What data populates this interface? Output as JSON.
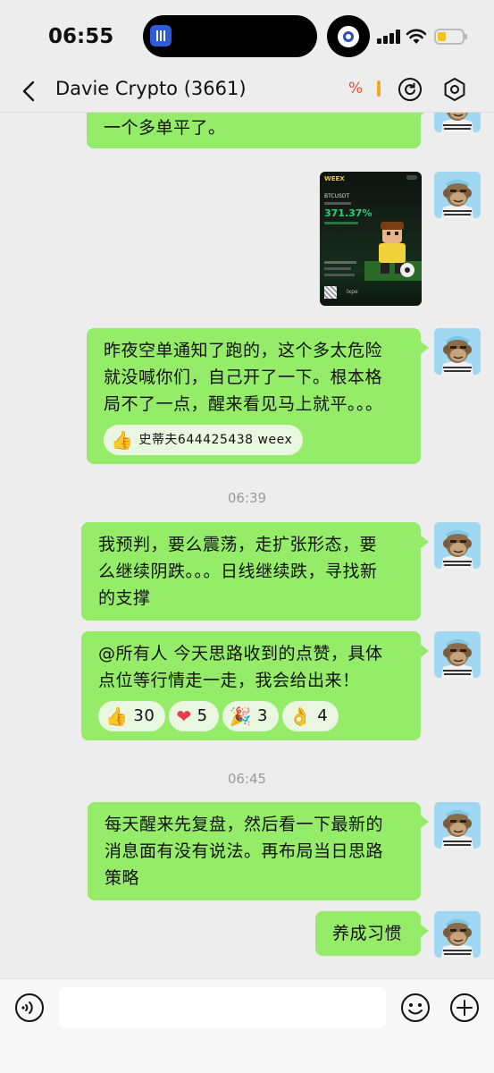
{
  "status_bar": {
    "time": "06:55"
  },
  "header": {
    "title": "Davie Crypto (3661)",
    "indicator": "%"
  },
  "messages": [
    {
      "text": "一个多单平了。"
    },
    {
      "type": "image",
      "card": {
        "brand": "WEEX",
        "pair": "BTCUSDT",
        "pnl": "371.37%",
        "footer": "lxpe"
      }
    },
    {
      "text_lines": [
        "昨夜空单通知了跑的，这个多太危险",
        "就没喊你们，自己开了一下。根本格",
        "局不了一点，醒来看见马上就平。。。"
      ],
      "reactions": [
        {
          "emoji": "👍",
          "label": "史蒂夫644425438 weex"
        }
      ]
    },
    {
      "timestamp": "06:39"
    },
    {
      "text_lines": [
        "我预判，要么震荡，走扩张形态，要",
        "么继续阴跌。。。日线继续跌，寻找新",
        "的支撑"
      ]
    },
    {
      "text_lines": [
        "@所有人 今天思路收到的点赞，具体",
        "点位等行情走一走，我会给出来！"
      ],
      "reactions": [
        {
          "emoji": "👍",
          "label": "30"
        },
        {
          "emoji": "❤",
          "label": "5"
        },
        {
          "emoji": "🎉",
          "label": "3"
        },
        {
          "emoji": "👌",
          "label": "4"
        }
      ]
    },
    {
      "timestamp": "06:45"
    },
    {
      "text_lines": [
        "每天醒来先复盘，然后看一下最新的",
        "消息面有没有说法。再布局当日思路",
        "策略"
      ]
    },
    {
      "text": "养成习惯"
    }
  ],
  "input": {
    "placeholder": ""
  },
  "colors": {
    "bubble": "#95ec69",
    "background": "#ededed",
    "accent_red": "#e64b3b"
  }
}
